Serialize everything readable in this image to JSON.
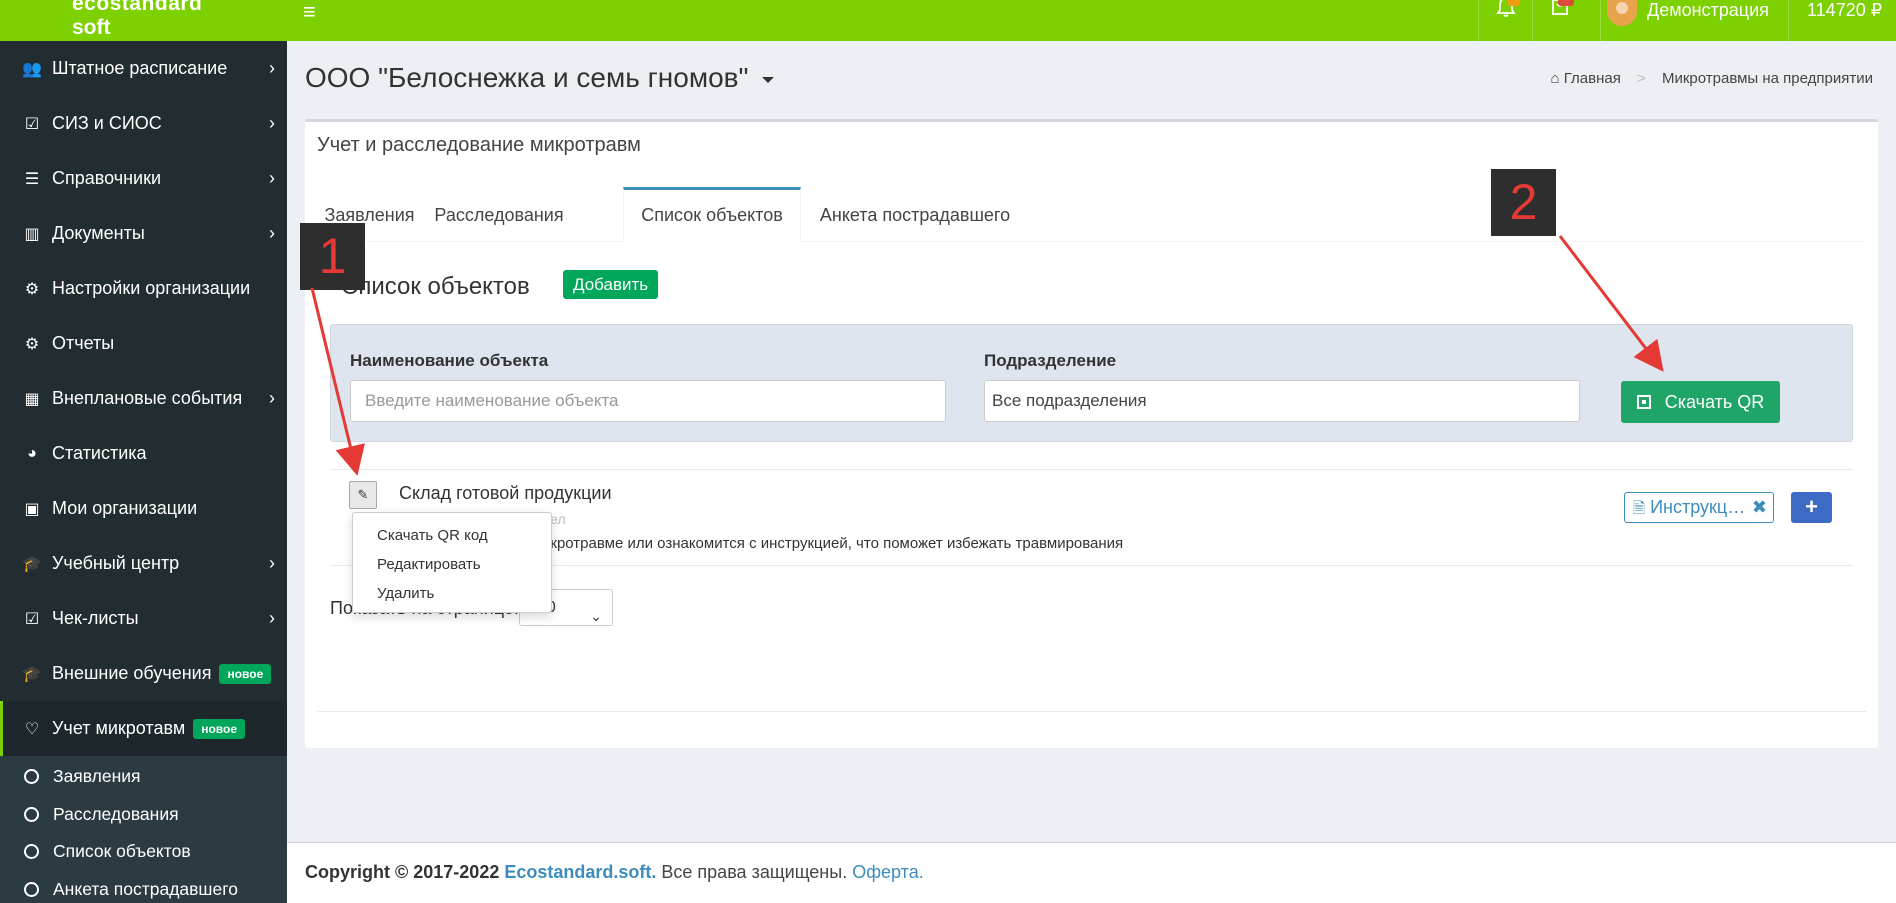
{
  "header": {
    "logo_line1": "ecostandard",
    "logo_line2": "soft",
    "menu_glyph": "≡",
    "user_name": "Демонстрация",
    "balance": "114720 ₽"
  },
  "sidebar": {
    "items": [
      {
        "label": "Штатное расписание",
        "icon": "users-icon",
        "glyph": "👥"
      },
      {
        "label": "СИЗ и СИОС",
        "icon": "calendar-check-icon",
        "glyph": "☑"
      },
      {
        "label": "Справочники",
        "icon": "list-icon",
        "glyph": "☰"
      },
      {
        "label": "Документы",
        "icon": "barcode-icon",
        "glyph": "▥"
      },
      {
        "label": "Настройки организации",
        "icon": "gear-icon",
        "glyph": "⚙"
      },
      {
        "label": "Отчеты",
        "icon": "gear-icon",
        "glyph": "⚙"
      },
      {
        "label": "Внеплановые события",
        "icon": "calendar-icon",
        "glyph": "▦"
      },
      {
        "label": "Статистика",
        "icon": "pie-chart-icon",
        "glyph": "◕"
      },
      {
        "label": "Мои организации",
        "icon": "briefcase-icon",
        "glyph": "▣"
      },
      {
        "label": "Учебный центр",
        "icon": "graduation-cap-icon",
        "glyph": "🎓"
      },
      {
        "label": "Чек-листы",
        "icon": "checkbox-icon",
        "glyph": "☑"
      },
      {
        "label": "Внешние обучения",
        "icon": "graduation-cap-icon",
        "glyph": "🎓",
        "badge": "новое"
      },
      {
        "label": "Учет микротавм",
        "icon": "heartbeat-icon",
        "glyph": "♡",
        "badge": "новое"
      }
    ],
    "subitems": [
      "Заявления",
      "Расследования",
      "Список объектов",
      "Анкета пострадавшего"
    ]
  },
  "page": {
    "org_title": "ООО \"Белоснежка и семь гномов\"",
    "breadcrumb_home": "Главная",
    "breadcrumb_current": "Микротравмы на предприятии",
    "box_title": "Учет и расследование микротравм",
    "tabs": [
      "Заявления",
      "Расследования",
      "Список объектов",
      "Анкета пострадавшего"
    ],
    "list_title": "Список объектов",
    "add_button": "Добавить",
    "filter": {
      "name_label": "Наименование объекта",
      "name_placeholder": "Введите наименование объекта",
      "division_label": "Подразделение",
      "division_value": "Все подразделения",
      "qr_button": "Скачать QR"
    },
    "object": {
      "name": "Склад готовой продукции",
      "division_hint": "дел",
      "description": "икротравме или ознакомится с инструкцией, что поможет избежать травмирования",
      "instruction_tag": "Инструкц…"
    },
    "dropdown": [
      "Скачать QR код",
      "Редактировать",
      "Удалить"
    ],
    "per_page_label": "Показать на странице:",
    "per_page_value": "10"
  },
  "footer": {
    "copyright": "Copyright © 2017-2022",
    "brand": "Ecostandard.soft.",
    "rights": "Все права защищены.",
    "offer": "Оферта."
  },
  "annotations": [
    "1",
    "2"
  ],
  "colors": {
    "header_green": "#7dd100",
    "sidebar_dark": "#222d32",
    "success_green": "#00a65a",
    "link_blue": "#3c8dbc",
    "annotation_red": "#e53935"
  }
}
